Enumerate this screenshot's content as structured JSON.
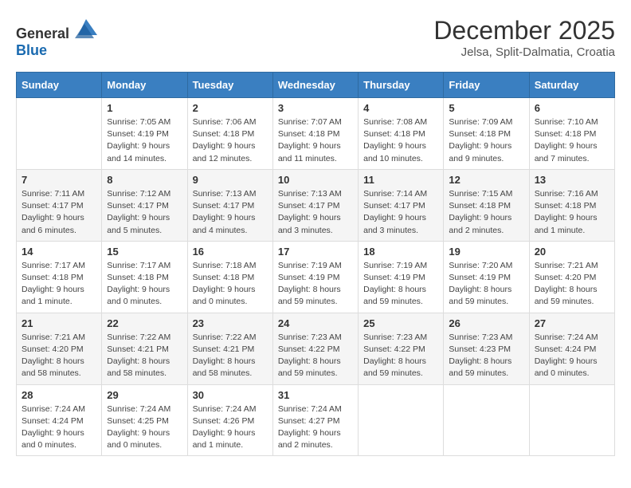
{
  "header": {
    "logo_general": "General",
    "logo_blue": "Blue",
    "month": "December 2025",
    "location": "Jelsa, Split-Dalmatia, Croatia"
  },
  "days_of_week": [
    "Sunday",
    "Monday",
    "Tuesday",
    "Wednesday",
    "Thursday",
    "Friday",
    "Saturday"
  ],
  "weeks": [
    [
      {
        "day": "",
        "sunrise": "",
        "sunset": "",
        "daylight": ""
      },
      {
        "day": "1",
        "sunrise": "Sunrise: 7:05 AM",
        "sunset": "Sunset: 4:19 PM",
        "daylight": "Daylight: 9 hours and 14 minutes."
      },
      {
        "day": "2",
        "sunrise": "Sunrise: 7:06 AM",
        "sunset": "Sunset: 4:18 PM",
        "daylight": "Daylight: 9 hours and 12 minutes."
      },
      {
        "day": "3",
        "sunrise": "Sunrise: 7:07 AM",
        "sunset": "Sunset: 4:18 PM",
        "daylight": "Daylight: 9 hours and 11 minutes."
      },
      {
        "day": "4",
        "sunrise": "Sunrise: 7:08 AM",
        "sunset": "Sunset: 4:18 PM",
        "daylight": "Daylight: 9 hours and 10 minutes."
      },
      {
        "day": "5",
        "sunrise": "Sunrise: 7:09 AM",
        "sunset": "Sunset: 4:18 PM",
        "daylight": "Daylight: 9 hours and 9 minutes."
      },
      {
        "day": "6",
        "sunrise": "Sunrise: 7:10 AM",
        "sunset": "Sunset: 4:18 PM",
        "daylight": "Daylight: 9 hours and 7 minutes."
      }
    ],
    [
      {
        "day": "7",
        "sunrise": "Sunrise: 7:11 AM",
        "sunset": "Sunset: 4:17 PM",
        "daylight": "Daylight: 9 hours and 6 minutes."
      },
      {
        "day": "8",
        "sunrise": "Sunrise: 7:12 AM",
        "sunset": "Sunset: 4:17 PM",
        "daylight": "Daylight: 9 hours and 5 minutes."
      },
      {
        "day": "9",
        "sunrise": "Sunrise: 7:13 AM",
        "sunset": "Sunset: 4:17 PM",
        "daylight": "Daylight: 9 hours and 4 minutes."
      },
      {
        "day": "10",
        "sunrise": "Sunrise: 7:13 AM",
        "sunset": "Sunset: 4:17 PM",
        "daylight": "Daylight: 9 hours and 3 minutes."
      },
      {
        "day": "11",
        "sunrise": "Sunrise: 7:14 AM",
        "sunset": "Sunset: 4:17 PM",
        "daylight": "Daylight: 9 hours and 3 minutes."
      },
      {
        "day": "12",
        "sunrise": "Sunrise: 7:15 AM",
        "sunset": "Sunset: 4:18 PM",
        "daylight": "Daylight: 9 hours and 2 minutes."
      },
      {
        "day": "13",
        "sunrise": "Sunrise: 7:16 AM",
        "sunset": "Sunset: 4:18 PM",
        "daylight": "Daylight: 9 hours and 1 minute."
      }
    ],
    [
      {
        "day": "14",
        "sunrise": "Sunrise: 7:17 AM",
        "sunset": "Sunset: 4:18 PM",
        "daylight": "Daylight: 9 hours and 1 minute."
      },
      {
        "day": "15",
        "sunrise": "Sunrise: 7:17 AM",
        "sunset": "Sunset: 4:18 PM",
        "daylight": "Daylight: 9 hours and 0 minutes."
      },
      {
        "day": "16",
        "sunrise": "Sunrise: 7:18 AM",
        "sunset": "Sunset: 4:18 PM",
        "daylight": "Daylight: 9 hours and 0 minutes."
      },
      {
        "day": "17",
        "sunrise": "Sunrise: 7:19 AM",
        "sunset": "Sunset: 4:19 PM",
        "daylight": "Daylight: 8 hours and 59 minutes."
      },
      {
        "day": "18",
        "sunrise": "Sunrise: 7:19 AM",
        "sunset": "Sunset: 4:19 PM",
        "daylight": "Daylight: 8 hours and 59 minutes."
      },
      {
        "day": "19",
        "sunrise": "Sunrise: 7:20 AM",
        "sunset": "Sunset: 4:19 PM",
        "daylight": "Daylight: 8 hours and 59 minutes."
      },
      {
        "day": "20",
        "sunrise": "Sunrise: 7:21 AM",
        "sunset": "Sunset: 4:20 PM",
        "daylight": "Daylight: 8 hours and 59 minutes."
      }
    ],
    [
      {
        "day": "21",
        "sunrise": "Sunrise: 7:21 AM",
        "sunset": "Sunset: 4:20 PM",
        "daylight": "Daylight: 8 hours and 58 minutes."
      },
      {
        "day": "22",
        "sunrise": "Sunrise: 7:22 AM",
        "sunset": "Sunset: 4:21 PM",
        "daylight": "Daylight: 8 hours and 58 minutes."
      },
      {
        "day": "23",
        "sunrise": "Sunrise: 7:22 AM",
        "sunset": "Sunset: 4:21 PM",
        "daylight": "Daylight: 8 hours and 58 minutes."
      },
      {
        "day": "24",
        "sunrise": "Sunrise: 7:23 AM",
        "sunset": "Sunset: 4:22 PM",
        "daylight": "Daylight: 8 hours and 59 minutes."
      },
      {
        "day": "25",
        "sunrise": "Sunrise: 7:23 AM",
        "sunset": "Sunset: 4:22 PM",
        "daylight": "Daylight: 8 hours and 59 minutes."
      },
      {
        "day": "26",
        "sunrise": "Sunrise: 7:23 AM",
        "sunset": "Sunset: 4:23 PM",
        "daylight": "Daylight: 8 hours and 59 minutes."
      },
      {
        "day": "27",
        "sunrise": "Sunrise: 7:24 AM",
        "sunset": "Sunset: 4:24 PM",
        "daylight": "Daylight: 9 hours and 0 minutes."
      }
    ],
    [
      {
        "day": "28",
        "sunrise": "Sunrise: 7:24 AM",
        "sunset": "Sunset: 4:24 PM",
        "daylight": "Daylight: 9 hours and 0 minutes."
      },
      {
        "day": "29",
        "sunrise": "Sunrise: 7:24 AM",
        "sunset": "Sunset: 4:25 PM",
        "daylight": "Daylight: 9 hours and 0 minutes."
      },
      {
        "day": "30",
        "sunrise": "Sunrise: 7:24 AM",
        "sunset": "Sunset: 4:26 PM",
        "daylight": "Daylight: 9 hours and 1 minute."
      },
      {
        "day": "31",
        "sunrise": "Sunrise: 7:24 AM",
        "sunset": "Sunset: 4:27 PM",
        "daylight": "Daylight: 9 hours and 2 minutes."
      },
      {
        "day": "",
        "sunrise": "",
        "sunset": "",
        "daylight": ""
      },
      {
        "day": "",
        "sunrise": "",
        "sunset": "",
        "daylight": ""
      },
      {
        "day": "",
        "sunrise": "",
        "sunset": "",
        "daylight": ""
      }
    ]
  ]
}
